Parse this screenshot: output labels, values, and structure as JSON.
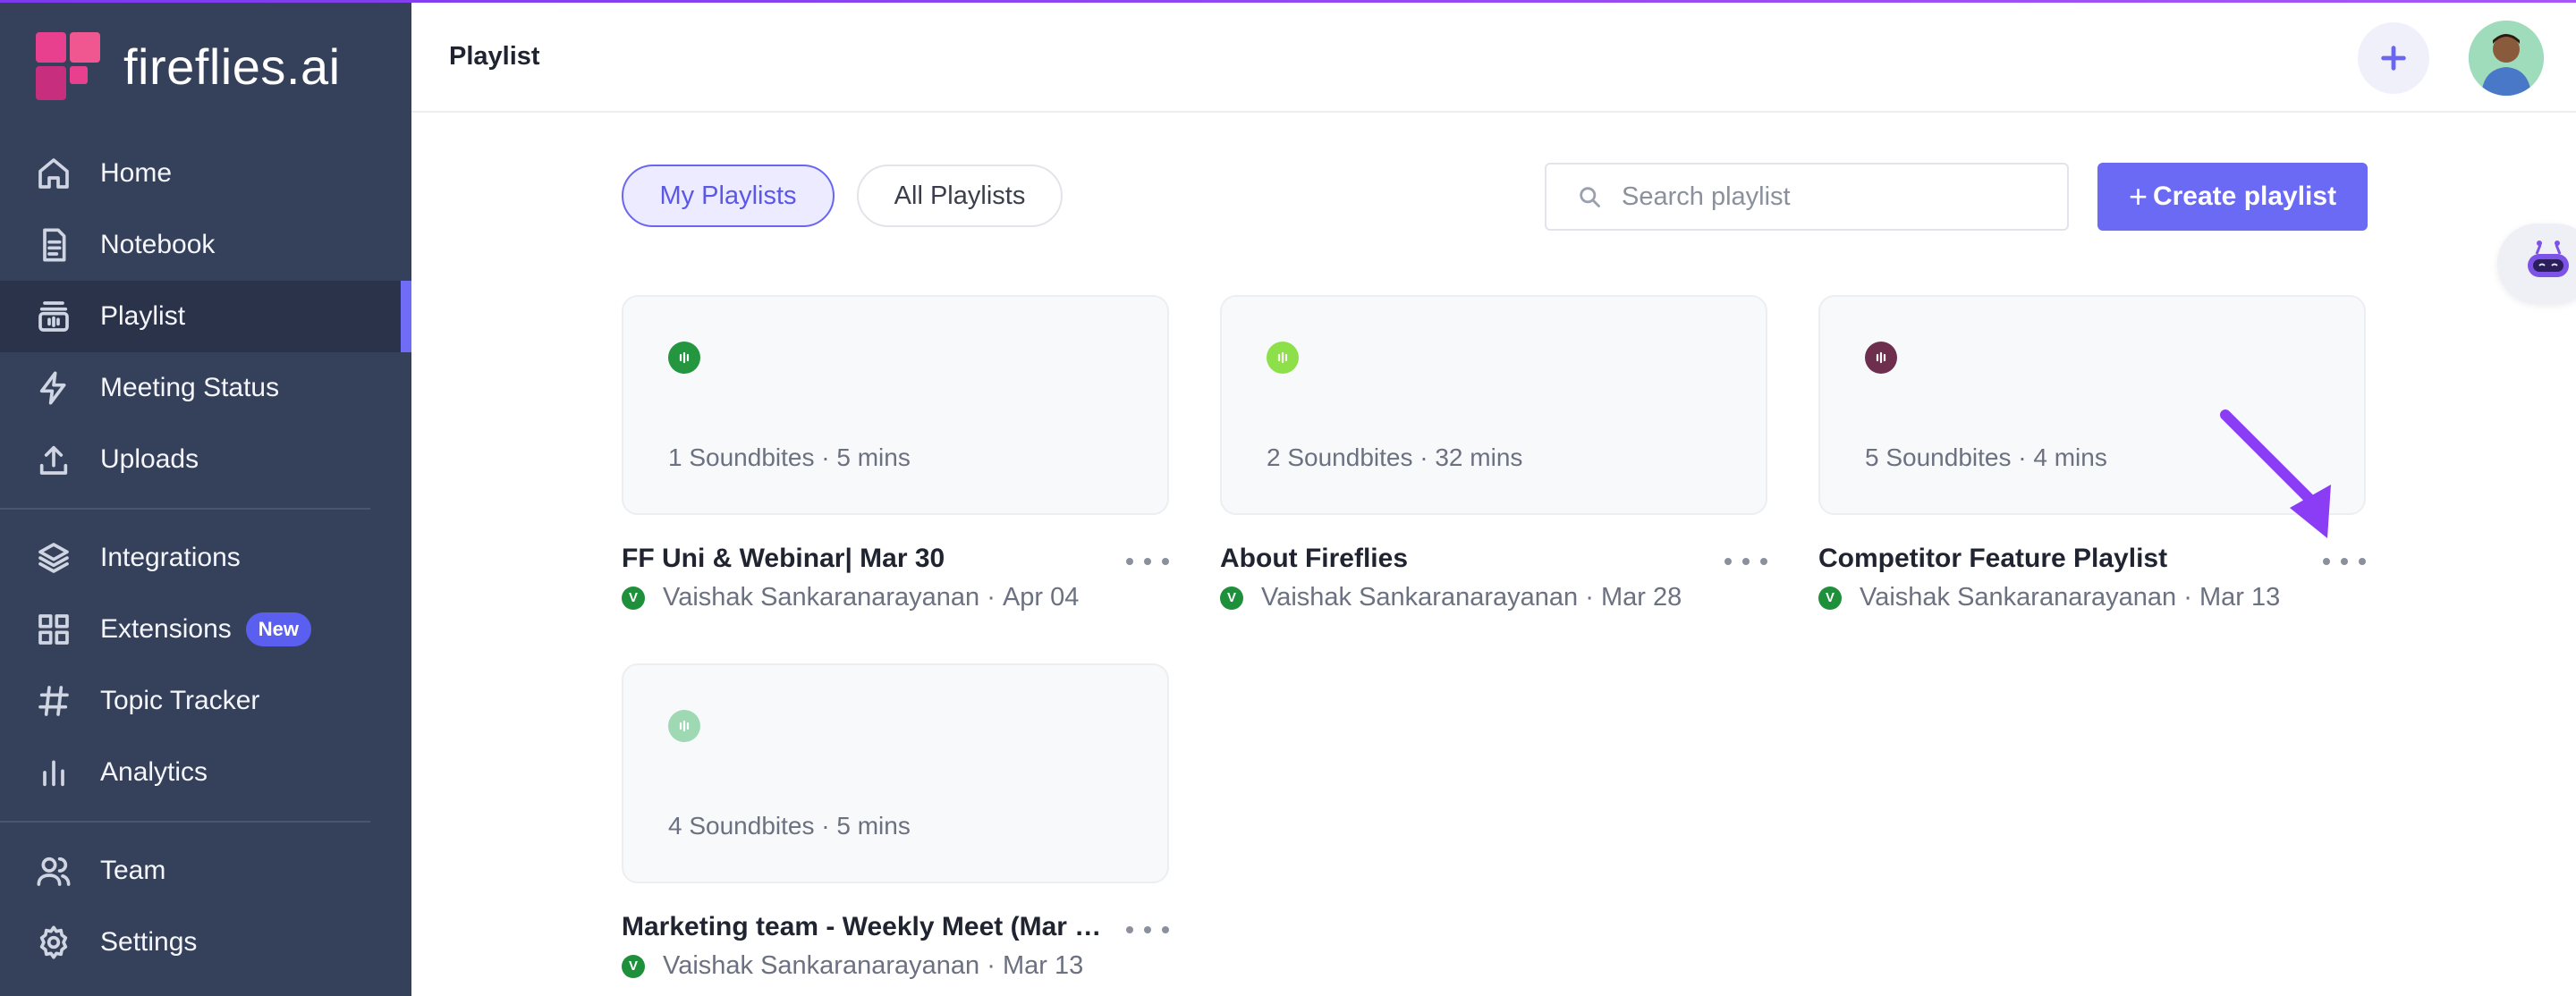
{
  "app": {
    "name": "fireflies.ai",
    "accent": "#6a6af4",
    "sidebar_bg": "#35415a"
  },
  "sidebar": {
    "items": [
      {
        "label": "Home",
        "icon": "home-icon"
      },
      {
        "label": "Notebook",
        "icon": "notebook-icon"
      },
      {
        "label": "Playlist",
        "icon": "playlist-icon",
        "active": true
      },
      {
        "label": "Meeting Status",
        "icon": "lightning-icon"
      },
      {
        "label": "Uploads",
        "icon": "upload-icon"
      },
      {
        "label": "Integrations",
        "icon": "layers-icon"
      },
      {
        "label": "Extensions",
        "icon": "grid-icon",
        "badge": "New"
      },
      {
        "label": "Topic Tracker",
        "icon": "hash-icon"
      },
      {
        "label": "Analytics",
        "icon": "bar-chart-icon"
      },
      {
        "label": "Team",
        "icon": "users-icon"
      },
      {
        "label": "Settings",
        "icon": "gear-icon"
      }
    ]
  },
  "header": {
    "title": "Playlist"
  },
  "filters": {
    "my_playlists": "My Playlists",
    "all_playlists": "All Playlists",
    "selected": "My Playlists"
  },
  "search": {
    "placeholder": "Search playlist",
    "value": ""
  },
  "create_button": {
    "plus": "+",
    "label": "Create playlist"
  },
  "playlists": [
    {
      "title": "FF Uni & Webinar| Mar 30",
      "stats": "1 Soundbites · 5 mins",
      "owner": "Vaishak Sankaranarayanan",
      "date": "Apr 04",
      "owner_initial": "V",
      "icon_color": "#23963f"
    },
    {
      "title": "About Fireflies",
      "stats": "2 Soundbites · 32 mins",
      "owner": "Vaishak Sankaranarayanan",
      "date": "Mar 28",
      "owner_initial": "V",
      "icon_color": "#8ee04a"
    },
    {
      "title": "Competitor Feature Playlist",
      "stats": "5 Soundbites · 4 mins",
      "owner": "Vaishak Sankaranarayanan",
      "date": "Mar 13",
      "owner_initial": "V",
      "icon_color": "#6d2f4d"
    },
    {
      "title": "Marketing team - Weekly Meet (Mar 2...",
      "stats": "4 Soundbites · 5 mins",
      "owner": "Vaishak Sankaranarayanan",
      "date": "Mar 13",
      "owner_initial": "V",
      "icon_color": "#9fd9b4"
    }
  ]
}
